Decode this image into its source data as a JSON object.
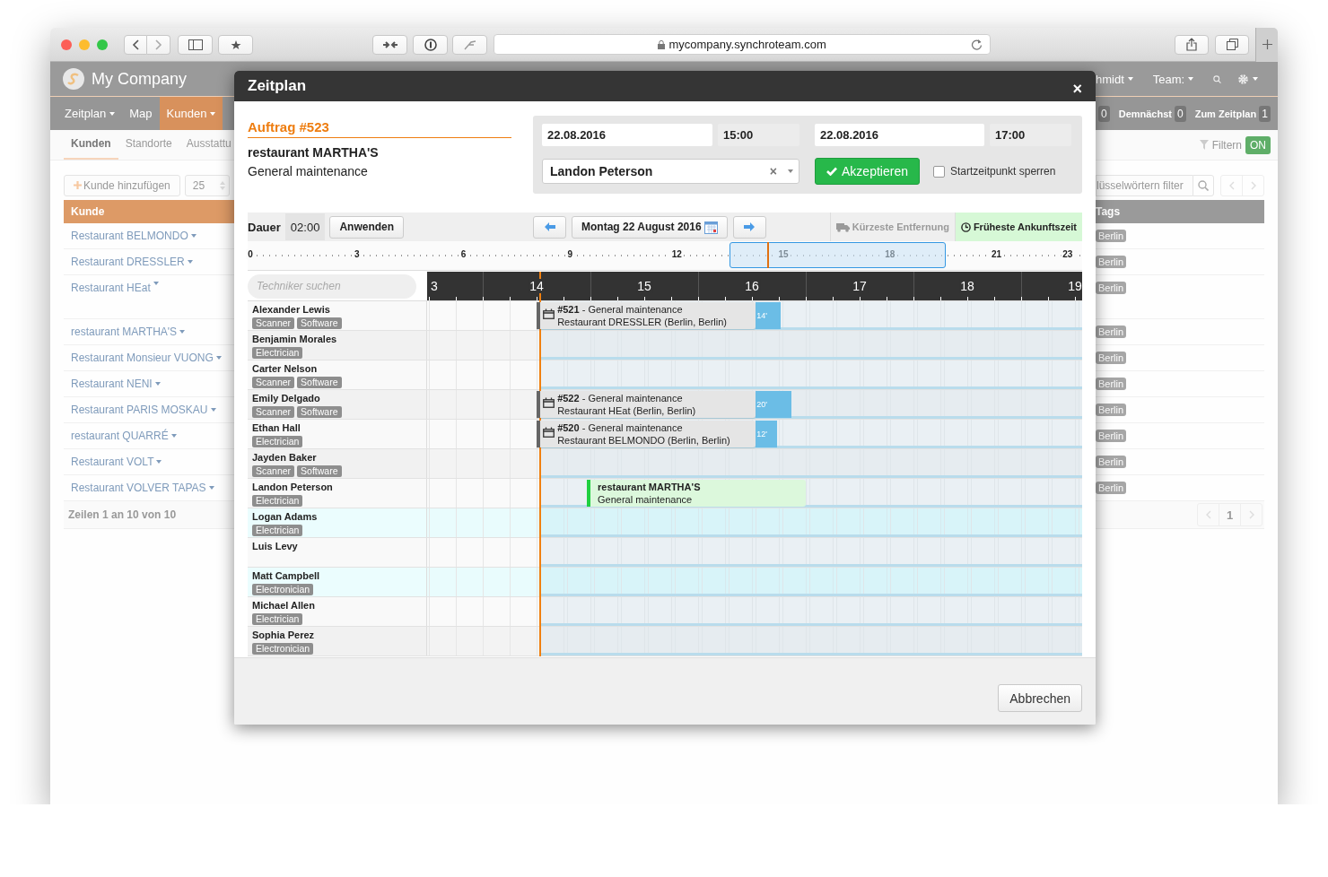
{
  "browser": {
    "url": "mycompany.synchroteam.com"
  },
  "app": {
    "brand": "My Company",
    "user_menu": "hmidt",
    "team_menu": "Team:",
    "nav": [
      {
        "label": "Zeitplan",
        "dropdown": true,
        "selected": false
      },
      {
        "label": "Map",
        "dropdown": false,
        "selected": false
      },
      {
        "label": "Kunden",
        "dropdown": true,
        "selected": true
      }
    ],
    "counters": [
      {
        "count": "0"
      },
      {
        "label": "Demnächst",
        "count": "0"
      },
      {
        "label": "Zum Zeitplan",
        "count": "1"
      }
    ],
    "subtabs": [
      {
        "label": "Kunden",
        "selected": true
      },
      {
        "label": "Standorte",
        "selected": false
      },
      {
        "label": "Ausstattu",
        "selected": false
      }
    ],
    "filter": {
      "label": "Filtern",
      "state": "ON"
    },
    "add_button": "Kunde hinzufügen",
    "page_size": "25",
    "search_placeholder": "lüsselwörtern filter",
    "table": {
      "columns": [
        "Kunde",
        "Tags"
      ],
      "rows": [
        {
          "name": "Restaurant BELMONDO",
          "tag": "Berlin",
          "tall": false
        },
        {
          "name": "Restaurant DRESSLER",
          "tag": "Berlin",
          "tall": false
        },
        {
          "name": "Restaurant HEat",
          "tag": "Berlin",
          "tall": true
        },
        {
          "name": "restaurant MARTHA'S",
          "tag": "Berlin",
          "tall": false
        },
        {
          "name": "Restaurant Monsieur VUONG",
          "tag": "Berlin",
          "tall": false
        },
        {
          "name": "Restaurant NENI",
          "tag": "Berlin",
          "tall": false
        },
        {
          "name": "Restaurant PARIS MOSKAU",
          "tag": "Berlin",
          "tall": false
        },
        {
          "name": "restaurant QUARRÉ",
          "tag": "Berlin",
          "tall": false
        },
        {
          "name": "Restaurant VOLT",
          "tag": "Berlin",
          "tall": false
        },
        {
          "name": "Restaurant VOLVER TAPAS",
          "tag": "Berlin",
          "tall": false
        }
      ]
    },
    "footer": "Zeilen 1 an 10 von 10",
    "pager_page": "1"
  },
  "dialog": {
    "title": "Zeitplan",
    "close": "×",
    "order": {
      "heading": "Auftrag #523",
      "customer": "restaurant MARTHA'S",
      "job": "General maintenance"
    },
    "form": {
      "start_date": "22.08.2016",
      "start_time": "15:00",
      "end_date": "22.08.2016",
      "end_time": "17:00",
      "technician": "Landon Peterson",
      "clear": "×",
      "accept": "Akzeptieren",
      "lock": {
        "label": "Startzeitpunkt sperren",
        "checked": false
      }
    },
    "toolbar": {
      "duration_label": "Dauer",
      "duration": "02:00",
      "apply": "Anwenden",
      "date": "Montag 22 August 2016",
      "sort_options": [
        {
          "kind": "distance",
          "label": "Kürzeste Entfernung",
          "selected": false
        },
        {
          "kind": "arrival",
          "label": "Früheste Ankunftszeit",
          "selected": true
        }
      ]
    },
    "overview_ticks": [
      "0",
      "3",
      "6",
      "9",
      "12",
      "15",
      "18",
      "21",
      "23"
    ],
    "now_marker": {
      "level": 0.6056
    },
    "search_placeholder": "Techniker suchen",
    "hours": [
      "3",
      "14",
      "15",
      "16",
      "17",
      "18",
      "19"
    ],
    "technicians": [
      {
        "name": "Alexander Lewis",
        "tags": [
          "Scanner",
          "Software"
        ],
        "available": false,
        "bookings": [
          {
            "kind": "job",
            "title": "**#521** - General maintenance",
            "location": "Restaurant DRESSLER (Berlin, Berlin)",
            "travel": "14'"
          }
        ]
      },
      {
        "name": "Benjamin Morales",
        "tags": [
          "Electrician"
        ],
        "available": false
      },
      {
        "name": "Carter Nelson",
        "tags": [
          "Scanner",
          "Software"
        ],
        "available": false
      },
      {
        "name": "Emily Delgado",
        "tags": [
          "Scanner",
          "Software"
        ],
        "available": false,
        "bookings": [
          {
            "kind": "job",
            "title": "**#522** - General maintenance",
            "location": "Restaurant HEat (Berlin, Berlin)",
            "travel": "20'"
          }
        ]
      },
      {
        "name": "Ethan Hall",
        "tags": [
          "Electrician"
        ],
        "available": false,
        "bookings": [
          {
            "kind": "job",
            "title": "**#520** - General maintenance",
            "location": "Restaurant BELMONDO (Berlin, Berlin)",
            "travel": "12'"
          }
        ]
      },
      {
        "name": "Jayden Baker",
        "tags": [
          "Scanner",
          "Software"
        ],
        "available": false
      },
      {
        "name": "Landon Peterson",
        "tags": [
          "Electrician"
        ],
        "available": false,
        "bookings": [
          {
            "kind": "proposal",
            "customer": "restaurant MARTHA'S",
            "job": "General maintenance"
          }
        ]
      },
      {
        "name": "Logan Adams",
        "tags": [
          "Electrician"
        ],
        "available": true
      },
      {
        "name": "Luis Levy",
        "available": false
      },
      {
        "name": "Matt Campbell",
        "tags": [
          "Electronician"
        ],
        "available": true
      },
      {
        "name": "Michael Allen",
        "tags": [
          "Electrician"
        ],
        "available": false
      },
      {
        "name": "Sophia Perez",
        "tags": [
          "Electronician"
        ],
        "available": false
      }
    ],
    "cancel": "Abbrechen"
  }
}
